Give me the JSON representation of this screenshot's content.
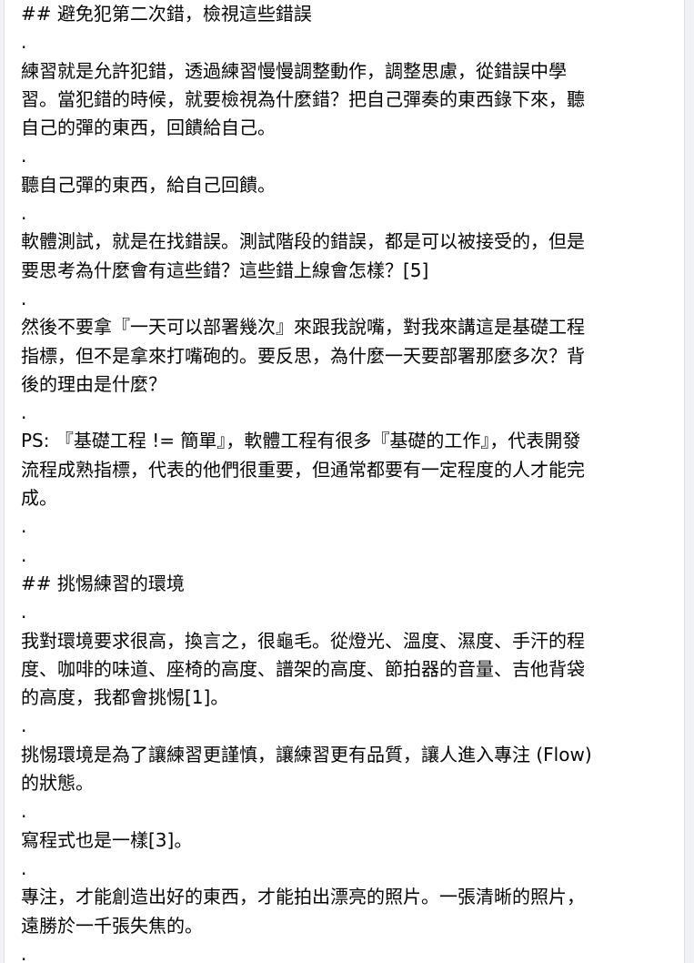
{
  "post": {
    "lines": [
      "## 避免犯第二次錯，檢視這些錯誤",
      ".",
      "練習就是允許犯錯，透過練習慢慢調整動作，調整思慮，從錯誤中學",
      "習。當犯錯的時候，就要檢視為什麼錯？把自己彈奏的東西錄下來，聽",
      "自己的彈的東西，回饋給自己。",
      ".",
      "聽自己彈的東西，給自己回饋。",
      ".",
      "軟體測試，就是在找錯誤。測試階段的錯誤，都是可以被接受的，但是",
      "要思考為什麼會有這些錯？這些錯上線會怎樣？[5]",
      ".",
      "然後不要拿『一天可以部署幾次』來跟我說嘴，對我來講這是基礎工程",
      "指標，但不是拿來打嘴砲的。要反思，為什麼一天要部署那麼多次？背",
      "後的理由是什麼？",
      ".",
      "PS: 『基礎工程 != 簡單』，軟體工程有很多『基礎的工作』，代表開發",
      "流程成熟指標，代表的他們很重要，但通常都要有一定程度的人才能完",
      "成。",
      ".",
      ".",
      "## 挑惕練習的環境",
      ".",
      "我對環境要求很高，換言之，很龜毛。從燈光、溫度、濕度、手汗的程",
      "度、咖啡的味道、座椅的高度、譜架的高度、節拍器的音量、吉他背袋",
      "的高度，我都會挑惕[1]。",
      ".",
      "挑惕環境是為了讓練習更謹慎，讓練習更有品質，讓人進入專注 (Flow)",
      "的狀態。",
      ".",
      "寫程式也是一樣[3]。",
      ".",
      "專注，才能創造出好的東西，才能拍出漂亮的照片。一張清晰的照片，",
      "遠勝於一千張失焦的。",
      "."
    ]
  }
}
